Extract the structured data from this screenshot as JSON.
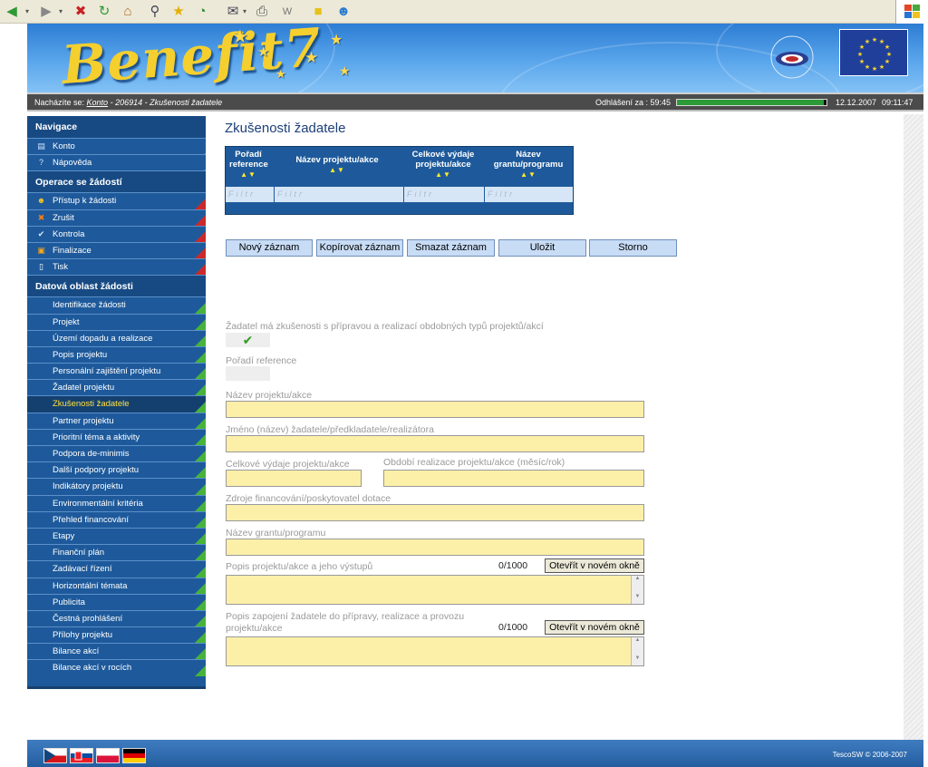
{
  "browser": {
    "icons": [
      "back-icon",
      "forward-icon",
      "stop-icon",
      "refresh-icon",
      "home-icon",
      "search-icon",
      "favorites-icon",
      "history-icon",
      "mail-icon",
      "print-icon",
      "edit-icon",
      "notes-icon",
      "messenger-icon",
      "windows-logo-icon"
    ]
  },
  "header": {
    "brand": "Benefit7"
  },
  "location": {
    "prefix": "Nacházíte se:",
    "konto": "Konto",
    "rest": "- 206914 - Zkušenosti žadatele",
    "logout": "Odhlášení za : 59:45",
    "date": "12.12.2007",
    "time": "09:11:47",
    "session_remaining_fraction": 0.99
  },
  "sidebar": {
    "navigace_title": "Navigace",
    "navigace": [
      {
        "label": "Konto",
        "icon": "account-icon"
      },
      {
        "label": "Nápověda",
        "icon": "help-icon"
      }
    ],
    "operace_title": "Operace se žádostí",
    "operace": [
      {
        "label": "Přístup k žádosti",
        "icon": "users-icon"
      },
      {
        "label": "Zrušit",
        "icon": "cancel-icon"
      },
      {
        "label": "Kontrola",
        "icon": "check-icon"
      },
      {
        "label": "Finalizace",
        "icon": "lock-icon"
      },
      {
        "label": "Tisk",
        "icon": "print-icon"
      }
    ],
    "data_title": "Datová oblast žádosti",
    "data": [
      "Identifikace žádosti",
      "Projekt",
      "Území dopadu a realizace",
      "Popis projektu",
      "Personální zajištění projektu",
      "Žadatel projektu",
      "Zkušenosti žadatele",
      "Partner projektu",
      "Prioritní téma a aktivity",
      "Podpora de-minimis",
      "Další podpory projektu",
      "Indikátory projektu",
      "Environmentální kritéria",
      "Přehled financování",
      "Etapy",
      "Finanční plán",
      "Zadávací řízení",
      "Horizontální témata",
      "Publicita",
      "Čestná prohlášení",
      "Přílohy projektu",
      "Bilance akcí",
      "Bilance akcí v rocích"
    ],
    "active": "Zkušenosti žadatele"
  },
  "main": {
    "title": "Zkušenosti žadatele",
    "grid": {
      "columns": [
        {
          "l1": "Pořadí",
          "l2": "reference"
        },
        {
          "l1": "Název projektu/akce",
          "l2": ""
        },
        {
          "l1": "Celkové výdaje",
          "l2": "projektu/akce"
        },
        {
          "l1": "Název",
          "l2": "grantu/programu"
        }
      ],
      "sort_arrows": "▲▼",
      "filter_placeholder": "Filtr"
    },
    "buttons": {
      "new": "Nový záznam",
      "copy": "Kopírovat záznam",
      "delete": "Smazat záznam",
      "save": "Uložit",
      "cancel": "Storno"
    },
    "form": {
      "experience_label": "Žadatel má zkušenosti s přípravou a realizací obdobných typů projektů/akcí",
      "experience_checked": true,
      "order_ref_label": "Pořadí reference",
      "project_name_label": "Název projektu/akce",
      "applicant_name_label": "Jméno (název) žadatele/předkladatele/realizátora",
      "total_cost_label": "Celkové výdaje projektu/akce",
      "period_label": "Období realizace projektu/akce (měsíc/rok)",
      "funding_source_label": "Zdroje financování/poskytovatel dotace",
      "grant_name_label": "Název grantu/programu",
      "description_label": "Popis projektu/akce a jeho výstupů",
      "description_counter": "0/1000",
      "involvement_label_1": "Popis zapojení žadatele do přípravy, realizace a provozu",
      "involvement_label_2": "projektu/akce",
      "involvement_counter": "0/1000",
      "open_window": "Otevřít v novém okně"
    }
  },
  "footer": {
    "flags": [
      "flag-cz-icon",
      "flag-sk-icon",
      "flag-pl-icon",
      "flag-de-icon"
    ],
    "copyright": "TescoSW © 2006-2007"
  }
}
